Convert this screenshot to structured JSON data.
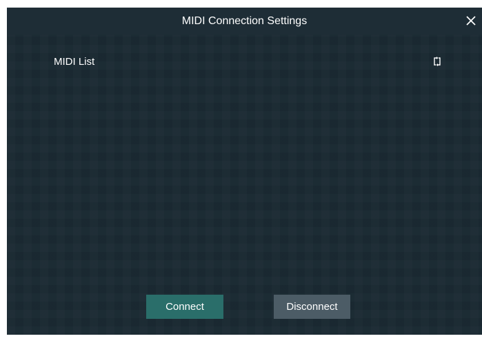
{
  "dialog": {
    "title": "MIDI Connection Settings",
    "close_icon": "close-icon"
  },
  "midi_list": {
    "label": "MIDI List",
    "refresh_icon": "refresh-icon",
    "items": []
  },
  "actions": {
    "connect_label": "Connect",
    "disconnect_label": "Disconnect"
  },
  "colors": {
    "background": "#1a2a33",
    "titlebar": "#1e2d36",
    "connect_button": "#2a6e6a",
    "disconnect_button": "#4c5c66",
    "text": "#ffffff"
  }
}
